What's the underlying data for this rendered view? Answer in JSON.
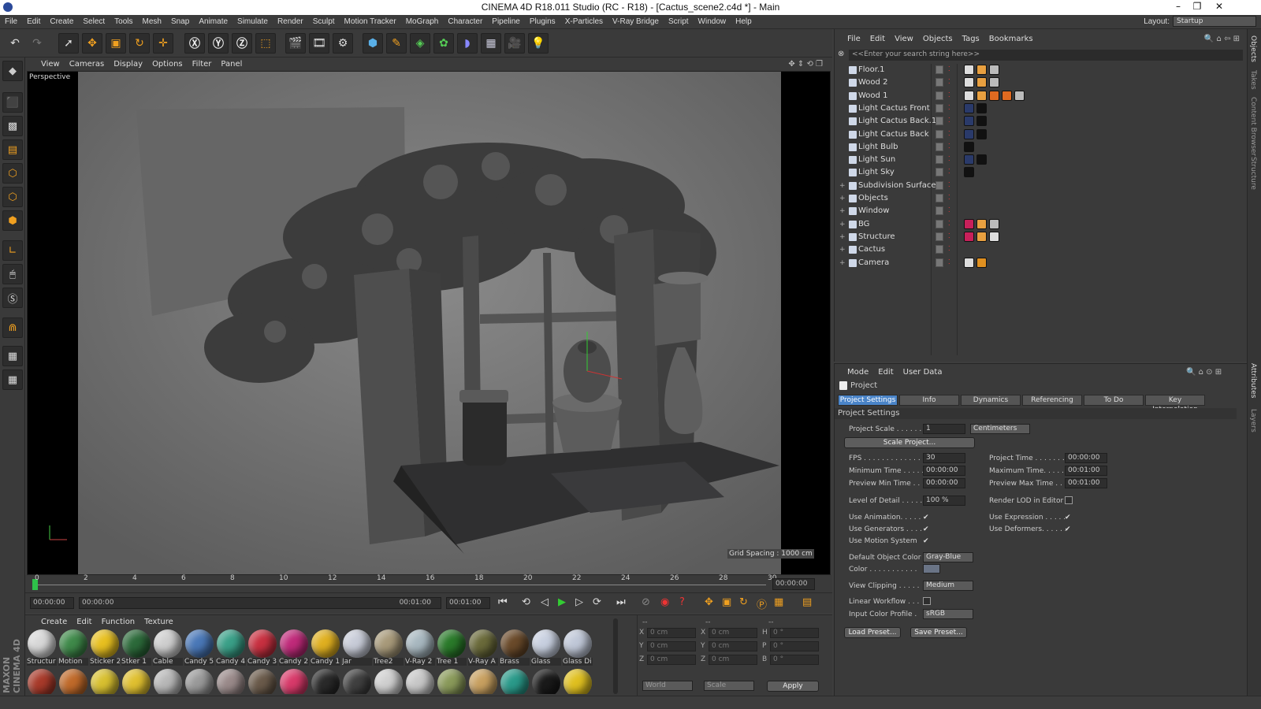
{
  "window": {
    "title": "CINEMA 4D R18.011 Studio (RC - R18) - [Cactus_scene2.c4d *] - Main"
  },
  "menu": [
    "File",
    "Edit",
    "Create",
    "Select",
    "Tools",
    "Mesh",
    "Snap",
    "Animate",
    "Simulate",
    "Render",
    "Sculpt",
    "Motion Tracker",
    "MoGraph",
    "Character",
    "Pipeline",
    "Plugins",
    "X-Particles",
    "V-Ray Bridge",
    "Script",
    "Window",
    "Help"
  ],
  "layout": {
    "label": "Layout:",
    "value": "Startup"
  },
  "viewport": {
    "menu": [
      "View",
      "Cameras",
      "Display",
      "Options",
      "Filter",
      "Panel"
    ],
    "label": "Perspective",
    "grid_spacing": "Grid Spacing : 1000 cm"
  },
  "timeline": {
    "ticks": [
      "0",
      "2",
      "4",
      "6",
      "8",
      "10",
      "12",
      "14",
      "16",
      "18",
      "20",
      "22",
      "24",
      "26",
      "28",
      "30"
    ],
    "current": "00:00:00",
    "start": "00:00:00",
    "range_start": "00:00:00",
    "range_end": "00:01:00",
    "end": "00:01:00"
  },
  "materials": {
    "menu": [
      "Create",
      "Edit",
      "Function",
      "Texture"
    ],
    "row1": [
      "Structur",
      "Motion",
      "Sticker 2",
      "Stker 1",
      "Cable",
      "Candy 5",
      "Candy 4",
      "Candy 3",
      "Candy 2",
      "Candy 1",
      "Jar",
      "Tree2",
      "V-Ray 2",
      "Tree 1",
      "V-Ray A",
      "Brass",
      "Glass",
      "Glass Di"
    ],
    "row1_colors": [
      "#d8d8d8",
      "#3f8a4a",
      "#e8c020",
      "#2c6a3a",
      "#cfcfcf",
      "#4a78b8",
      "#3aa088",
      "#c83040",
      "#c02a7a",
      "#e0b020",
      "#c8ccd8",
      "#a89a7a",
      "#a8b8c0",
      "#2a7a2a",
      "#6a6a3a",
      "#6a4a2a",
      "#c8d0e0",
      "#c0c8d8"
    ],
    "row2_colors": [
      "#a83a2a",
      "#c06a2a",
      "#d8c030",
      "#e0c030",
      "#b8b8b8",
      "#9a9a9a",
      "#9a8a8a",
      "#6a5a4a",
      "#d83a6a",
      "#2a2a2a",
      "#404040",
      "#d0d0d0",
      "#c8c8c8",
      "#8a9a5a",
      "#c8a060",
      "#2a9a8a",
      "#1a1a1a",
      "#e0c020"
    ]
  },
  "coords": {
    "headers": [
      "--",
      "--",
      "--"
    ],
    "rows": [
      [
        "X",
        "0 cm",
        "X",
        "0 cm",
        "H",
        "0 °"
      ],
      [
        "Y",
        "0 cm",
        "Y",
        "0 cm",
        "P",
        "0 °"
      ],
      [
        "Z",
        "0 cm",
        "Z",
        "0 cm",
        "B",
        "0 °"
      ]
    ],
    "world": "World",
    "scale": "Scale",
    "apply": "Apply"
  },
  "objects": {
    "menu": [
      "File",
      "Edit",
      "View",
      "Objects",
      "Tags",
      "Bookmarks"
    ],
    "search": "<<Enter your search string here>>",
    "rows": [
      {
        "name": "Floor.1",
        "expand": "",
        "tags": [
          "#ddd",
          "#e8a040",
          "#bbb"
        ]
      },
      {
        "name": "Wood 2",
        "expand": "",
        "tags": [
          "#ddd",
          "#e8a040",
          "#bbb"
        ]
      },
      {
        "name": "Wood 1",
        "expand": "",
        "tags": [
          "#ddd",
          "#e8a040",
          "#e06a20",
          "#e06a20",
          "#bbb"
        ]
      },
      {
        "name": "Light Cactus Front",
        "expand": "",
        "tags": [
          "#2a3a6a",
          "#111"
        ]
      },
      {
        "name": "Light Cactus Back.1",
        "expand": "",
        "tags": [
          "#2a3a6a",
          "#111"
        ]
      },
      {
        "name": "Light Cactus Back",
        "expand": "",
        "tags": [
          "#2a3a6a",
          "#111"
        ]
      },
      {
        "name": "Light Bulb",
        "expand": "",
        "tags": [
          "#111"
        ]
      },
      {
        "name": "Light Sun",
        "expand": "",
        "tags": [
          "#2a3a6a",
          "#111"
        ]
      },
      {
        "name": "Light Sky",
        "expand": "",
        "tags": [
          "#111"
        ]
      },
      {
        "name": "Subdivision Surface",
        "expand": "+",
        "tags": []
      },
      {
        "name": "Objects",
        "expand": "+",
        "tags": []
      },
      {
        "name": "Window",
        "expand": "+",
        "tags": []
      },
      {
        "name": "BG",
        "expand": "+",
        "tags": [
          "#c8205a",
          "#e8a040",
          "#bbb"
        ]
      },
      {
        "name": "Structure",
        "expand": "+",
        "tags": [
          "#c8205a",
          "#e8a040",
          "#ddd"
        ]
      },
      {
        "name": "Cactus",
        "expand": "+",
        "tags": []
      },
      {
        "name": "Camera",
        "expand": "+",
        "tags": [
          "#ddd",
          "#e09020"
        ]
      }
    ]
  },
  "attributes": {
    "menu": [
      "Mode",
      "Edit",
      "User Data"
    ],
    "object": "Project",
    "tabs": [
      "Project Settings",
      "Info",
      "Dynamics",
      "Referencing",
      "To Do",
      "Key Interpolation"
    ],
    "section": "Project Settings",
    "project_scale": "Project Scale . . . . . .",
    "project_scale_val": "1",
    "unit": "Centimeters",
    "scale_project": "Scale Project...",
    "fps": "FPS . . . . . . . . . . . . . . . .",
    "fps_val": "30",
    "project_time": "Project Time . . . . . . .",
    "project_time_val": "00:00:00",
    "min_time": "Minimum Time . . . . .",
    "min_time_val": "00:00:00",
    "max_time": "Maximum Time. . . . . .",
    "max_time_val": "00:01:00",
    "prev_min": "Preview Min Time . . .",
    "prev_min_val": "00:00:00",
    "prev_max": "Preview Max Time . . .",
    "prev_max_val": "00:01:00",
    "lod": "Level of Detail . . . . .",
    "lod_val": "100 %",
    "render_lod": "Render LOD in Editor",
    "use_anim": "Use Animation. . . . .",
    "use_expr": "Use Expression . . . . .",
    "use_gen": "Use Generators . . . .",
    "use_def": "Use Deformers. . . . . .",
    "use_motion": "Use Motion System",
    "def_color": "Default Object Color",
    "def_color_val": "Gray-Blue",
    "color": "Color . . . . . . . . . . .",
    "view_clip": "View Clipping . . . . .",
    "view_clip_val": "Medium",
    "linear": "Linear Workflow . . .",
    "input_profile": "Input Color Profile .",
    "input_profile_val": "sRGB",
    "load": "Load Preset...",
    "save": "Save Preset..."
  },
  "sidetabs": [
    "Objects",
    "Takes",
    "Content Browser",
    "Structure",
    "Attributes",
    "Layers"
  ],
  "brand": "MAXON CINEMA 4D"
}
